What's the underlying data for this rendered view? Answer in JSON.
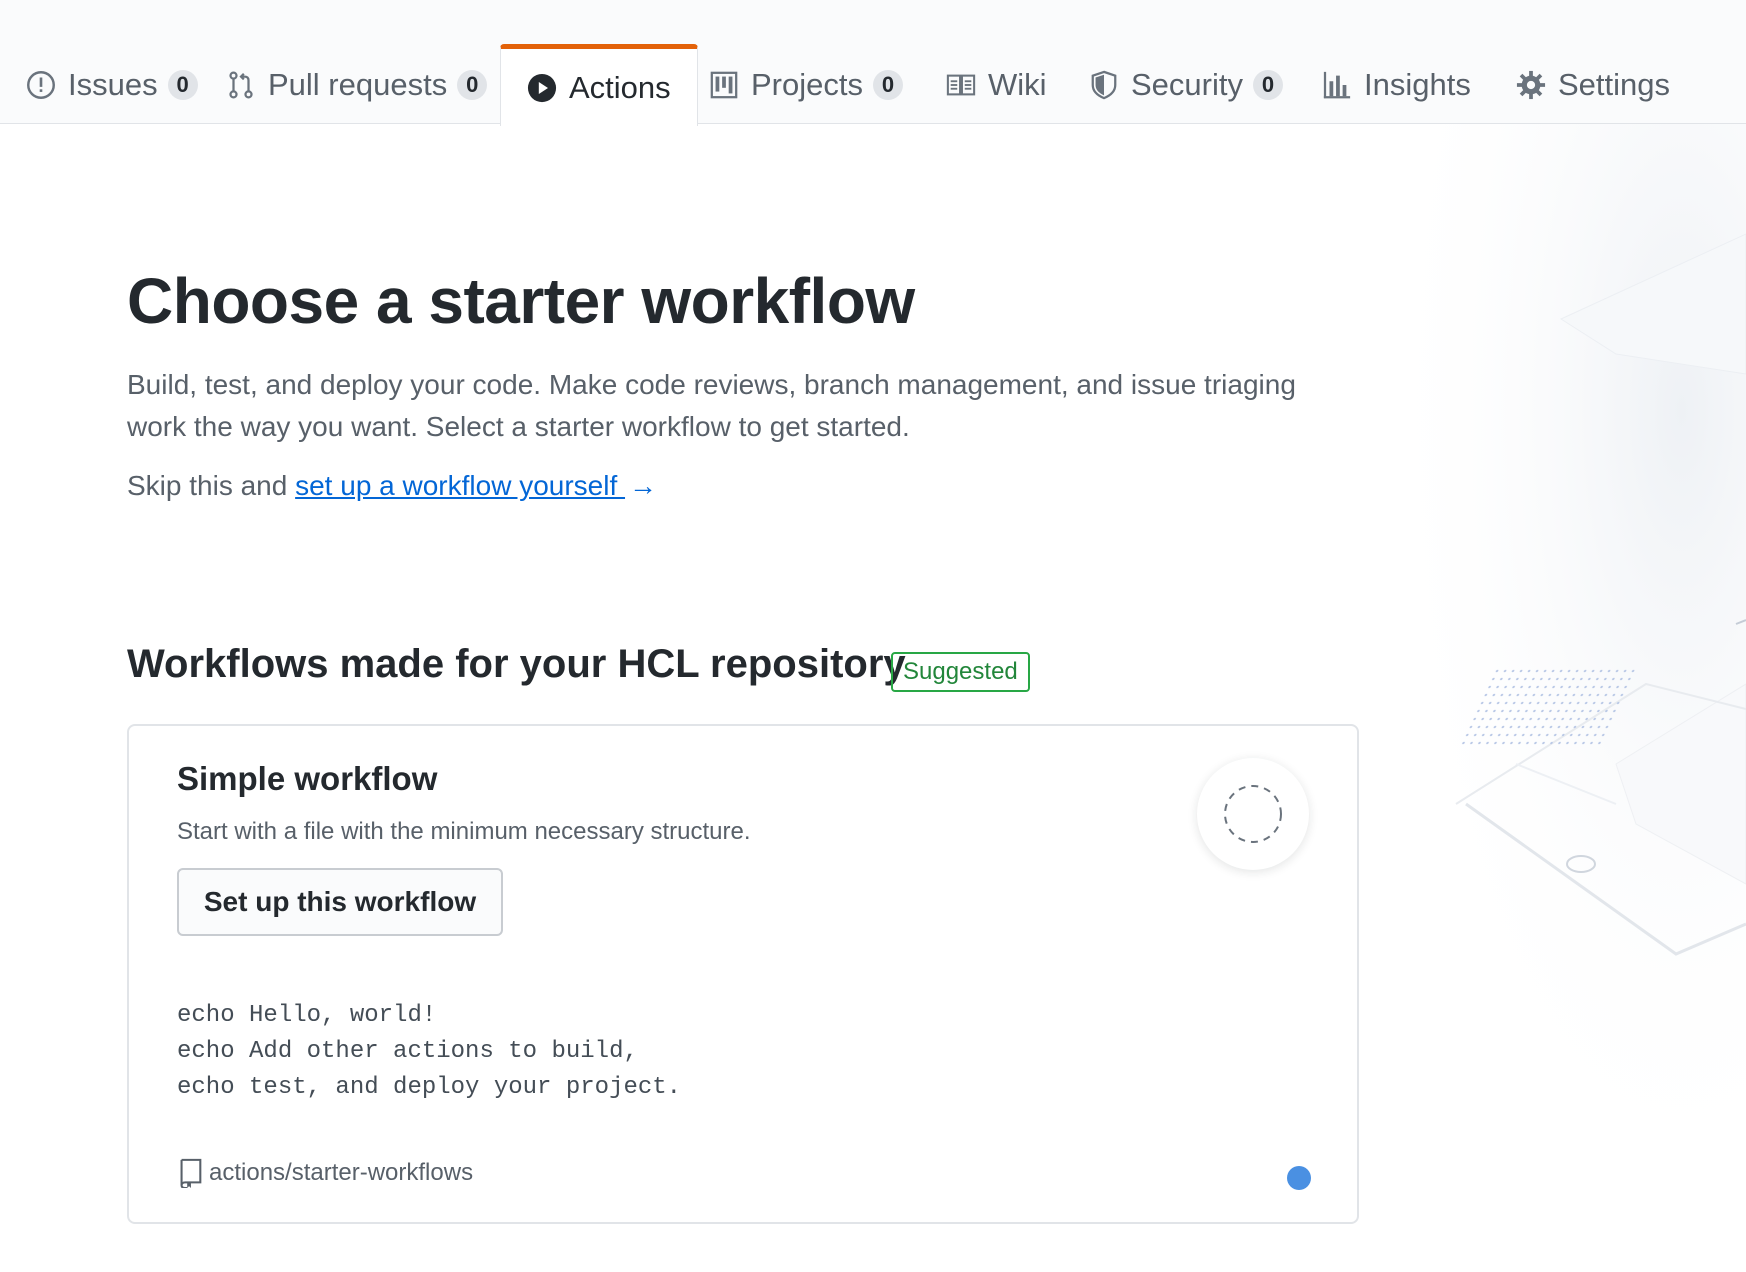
{
  "tabs": [
    {
      "label": "Issues",
      "count": "0",
      "icon": "issue-opened-icon"
    },
    {
      "label": "Pull requests",
      "count": "0",
      "icon": "git-pull-request-icon"
    },
    {
      "label": "Actions",
      "icon": "play-icon",
      "selected": true
    },
    {
      "label": "Projects",
      "count": "0",
      "icon": "project-icon"
    },
    {
      "label": "Wiki",
      "icon": "book-icon"
    },
    {
      "label": "Security",
      "count": "0",
      "icon": "shield-icon"
    },
    {
      "label": "Insights",
      "icon": "graph-icon"
    },
    {
      "label": "Settings",
      "icon": "gear-icon"
    }
  ],
  "header": {
    "title": "Choose a starter workflow",
    "lead": "Build, test, and deploy your code. Make code reviews, branch management, and issue triaging work the way you want. Select a starter workflow to get started.",
    "skip_prefix": "Skip this and ",
    "skip_link": "set up a workflow yourself ",
    "skip_arrow": "→"
  },
  "section": {
    "title": "Workflows made for your HCL repository",
    "badge": "Suggested"
  },
  "card": {
    "title": "Simple workflow",
    "description": "Start with a file with the minimum necessary structure.",
    "button": "Set up this workflow",
    "code": "echo Hello, world!\necho Add other actions to build,\necho test, and deploy your project.",
    "repo": "actions/starter-workflows",
    "language_color": "#4a90e2"
  },
  "colors": {
    "accent_tab": "#e36209",
    "link": "#0366d6",
    "suggested": "#28a745"
  }
}
